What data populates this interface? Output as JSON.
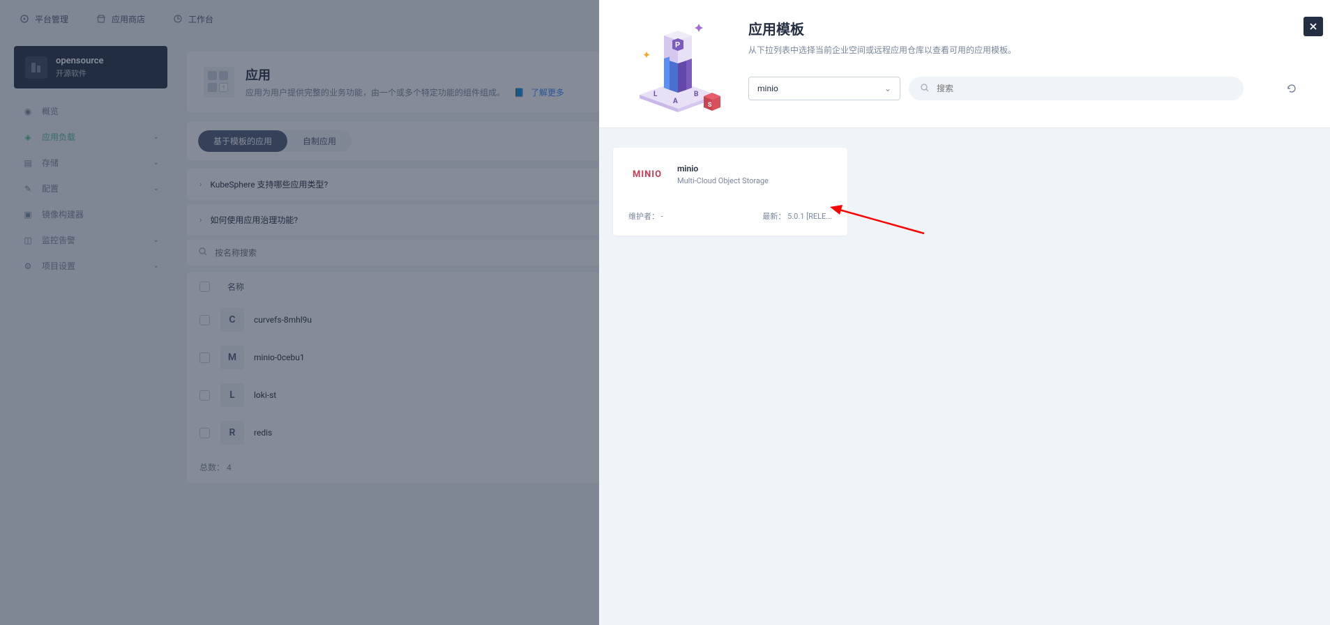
{
  "topbar": {
    "platform": "平台管理",
    "store": "应用商店",
    "workbench": "工作台"
  },
  "sidebar": {
    "project": {
      "name": "opensource",
      "sub": "开源软件"
    },
    "items": [
      {
        "icon": "overview",
        "label": "概览",
        "expandable": false
      },
      {
        "icon": "workload",
        "label": "应用负载",
        "expandable": true,
        "active": true
      },
      {
        "icon": "storage",
        "label": "存储",
        "expandable": true
      },
      {
        "icon": "config",
        "label": "配置",
        "expandable": true
      },
      {
        "icon": "builder",
        "label": "镜像构建器",
        "expandable": false
      },
      {
        "icon": "monitor",
        "label": "监控告警",
        "expandable": true
      },
      {
        "icon": "settings",
        "label": "项目设置",
        "expandable": true
      }
    ]
  },
  "page": {
    "title": "应用",
    "desc": "应用为用户提供完整的业务功能，由一个或多个特定功能的组件组成。",
    "learn_more": "了解更多"
  },
  "tabs": {
    "template": "基于模板的应用",
    "custom": "自制应用"
  },
  "faq": [
    "KubeSphere 支持哪些应用类型?",
    "如何使用应用治理功能?"
  ],
  "search": {
    "placeholder": "按名称搜索"
  },
  "table": {
    "header": "名称",
    "rows": [
      {
        "letter": "C",
        "name": "curvefs-8mhl9u"
      },
      {
        "letter": "M",
        "name": "minio-0cebu1"
      },
      {
        "letter": "L",
        "name": "loki-st"
      },
      {
        "letter": "R",
        "name": "redis"
      }
    ],
    "total_label": "总数：",
    "total_value": "4"
  },
  "modal": {
    "title": "应用模板",
    "subtitle": "从下拉列表中选择当前企业空间或远程应用仓库以查看可用的应用模板。",
    "select_value": "minio",
    "search_placeholder": "搜索",
    "app": {
      "logo_text": "MINIO",
      "name": "minio",
      "desc": "Multi-Cloud Object Storage",
      "maintainer_label": "维护者：",
      "maintainer_value": "-",
      "latest_label": "最新：",
      "latest_value": "5.0.1 [RELE..."
    }
  }
}
